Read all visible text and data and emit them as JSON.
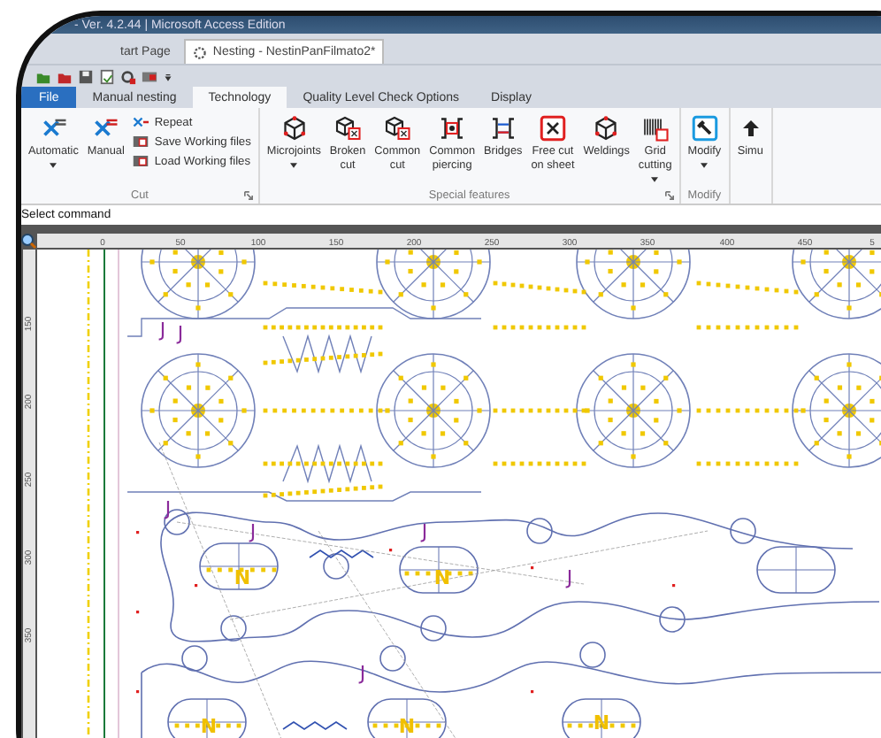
{
  "window": {
    "title": "- Ver. 4.2.44 | Microsoft Access Edition"
  },
  "document_tabs": [
    {
      "label": "tart Page",
      "selected": false
    },
    {
      "label": "Nesting - NestinPanFilmato2*",
      "selected": true
    }
  ],
  "ribbon_tabs": [
    {
      "label": "File",
      "kind": "file",
      "selected": false
    },
    {
      "label": "Manual nesting",
      "kind": "tab",
      "selected": false
    },
    {
      "label": "Technology",
      "kind": "tab",
      "selected": true
    },
    {
      "label": "Quality Level Check Options",
      "kind": "tab",
      "selected": false
    },
    {
      "label": "Display",
      "kind": "tab",
      "selected": false
    }
  ],
  "ribbon_groups": [
    {
      "label": "Cut",
      "launcher": true,
      "buttons": [
        {
          "kind": "large",
          "lines": [
            "Automatic"
          ],
          "dropdown": true
        },
        {
          "kind": "large",
          "lines": [
            "Manual"
          ],
          "dropdown": false
        },
        {
          "kind": "stack",
          "items": [
            "Repeat",
            "Save Working files",
            "Load Working files"
          ]
        }
      ]
    },
    {
      "label": "Special features",
      "launcher": true,
      "buttons": [
        {
          "kind": "large",
          "lines": [
            "Microjoints"
          ],
          "dropdown": true
        },
        {
          "kind": "large",
          "lines": [
            "Broken",
            "cut"
          ],
          "dropdown": false
        },
        {
          "kind": "large",
          "lines": [
            "Common",
            "cut"
          ],
          "dropdown": false
        },
        {
          "kind": "large",
          "lines": [
            "Common",
            "piercing"
          ],
          "dropdown": false
        },
        {
          "kind": "large",
          "lines": [
            "Bridges"
          ],
          "dropdown": false
        },
        {
          "kind": "large",
          "lines": [
            "Free cut",
            "on sheet"
          ],
          "dropdown": false
        },
        {
          "kind": "large",
          "lines": [
            "Weldings"
          ],
          "dropdown": false
        },
        {
          "kind": "large",
          "lines": [
            "Grid",
            "cutting"
          ],
          "dropdown": true
        }
      ]
    },
    {
      "label": "Modify",
      "launcher": false,
      "buttons": [
        {
          "kind": "large",
          "lines": [
            "Modify"
          ],
          "dropdown": true
        }
      ]
    },
    {
      "launcher": false,
      "buttons": [
        {
          "kind": "large",
          "lines": [
            "Simu"
          ],
          "dropdown": false
        }
      ]
    }
  ],
  "command_prompt": "Select command",
  "ruler": {
    "x_labels": [
      "0",
      "50",
      "100",
      "150",
      "200",
      "250",
      "300",
      "350",
      "400",
      "450",
      "5"
    ],
    "y_labels": [
      "150",
      "200",
      "250",
      "300",
      "350"
    ]
  },
  "part_marks": [
    "J",
    "J",
    "J",
    "J",
    "J",
    "J",
    "J",
    "N",
    "N",
    "N",
    "N",
    "N"
  ]
}
